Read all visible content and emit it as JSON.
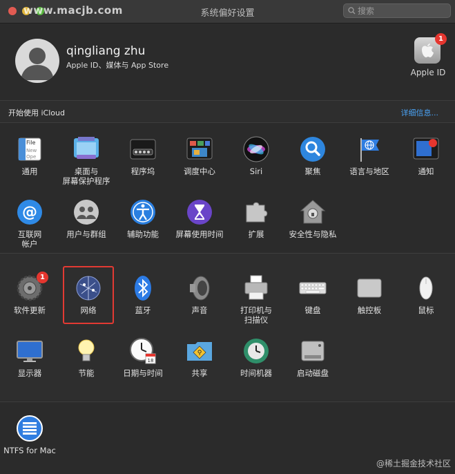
{
  "window": {
    "title": "系统偏好设置",
    "watermark": "www.macjb.com",
    "search_placeholder": "搜索"
  },
  "account": {
    "name": "qingliang zhu",
    "subtitle": "Apple ID、媒体与 App Store",
    "apple_id_label": "Apple ID",
    "apple_id_badge": "1"
  },
  "icloud": {
    "prompt": "开始使用 iCloud",
    "details_link": "详细信息..."
  },
  "panes_row1": [
    "通用",
    "桌面与\n屏幕保护程序",
    "程序坞",
    "调度中心",
    "Siri",
    "聚焦",
    "语言与地区",
    "通知"
  ],
  "panes_row2": [
    "互联网\n帐户",
    "用户与群组",
    "辅助功能",
    "屏幕使用时间",
    "扩展",
    "安全性与隐私"
  ],
  "panes_row3": [
    "软件更新",
    "网络",
    "蓝牙",
    "声音",
    "打印机与\n扫描仪",
    "键盘",
    "触控板",
    "鼠标"
  ],
  "panes_row4": [
    "显示器",
    "节能",
    "日期与时间",
    "共享",
    "时间机器",
    "启动磁盘"
  ],
  "panes_other": [
    "NTFS for Mac"
  ],
  "software_update_badge": "1",
  "selected_pane": "网络",
  "footer_watermark": "@稀土掘金技术社区",
  "colors": {
    "background": "#2b2b2b",
    "accent_link": "#4aa3f5",
    "badge": "#e5362f",
    "selection": "#e33a33"
  }
}
